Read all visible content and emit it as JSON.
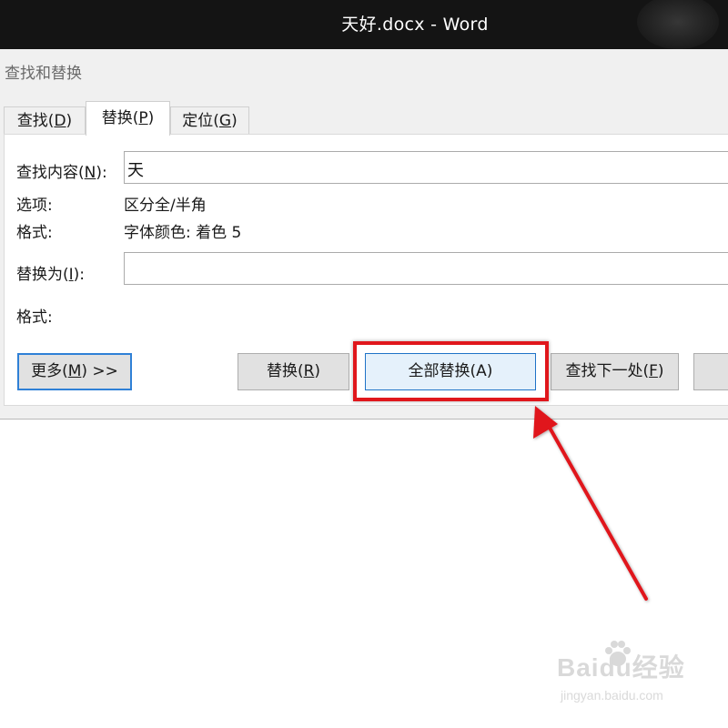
{
  "window": {
    "title": "天好.docx  -  Word"
  },
  "dialog": {
    "title": "查找和替换",
    "tabs": [
      {
        "label_pre": "查找(",
        "mnemonic": "D",
        "label_post": ")"
      },
      {
        "label_pre": "替换(",
        "mnemonic": "P",
        "label_post": ")"
      },
      {
        "label_pre": "定位(",
        "mnemonic": "G",
        "label_post": ")"
      }
    ],
    "find": {
      "label_pre": "查找内容(",
      "mnemonic": "N",
      "label_post": "):",
      "value": "天",
      "options_label": "选项:",
      "options_value": "区分全/半角",
      "format_label": "格式:",
      "format_value": "字体颜色: 着色 5"
    },
    "replace": {
      "label_pre": "替换为(",
      "mnemonic": "I",
      "label_post": "):",
      "value": "",
      "format_label": "格式:"
    },
    "buttons": {
      "more": {
        "label_pre": "更多(",
        "mnemonic": "M",
        "label_post": ") >>"
      },
      "replace": {
        "label_pre": "替换(",
        "mnemonic": "R",
        "label_post": ")"
      },
      "replace_all": {
        "label": "全部替换(A)"
      },
      "find_next": {
        "label_pre": "查找下一处(",
        "mnemonic": "F",
        "label_post": ")"
      },
      "cancel": {
        "label": ""
      }
    }
  },
  "annotation": {
    "highlight_color": "#e0171c",
    "target": "replace_all"
  },
  "watermark": {
    "brand": "Baidu经验",
    "url": "jingyan.baidu.com"
  }
}
